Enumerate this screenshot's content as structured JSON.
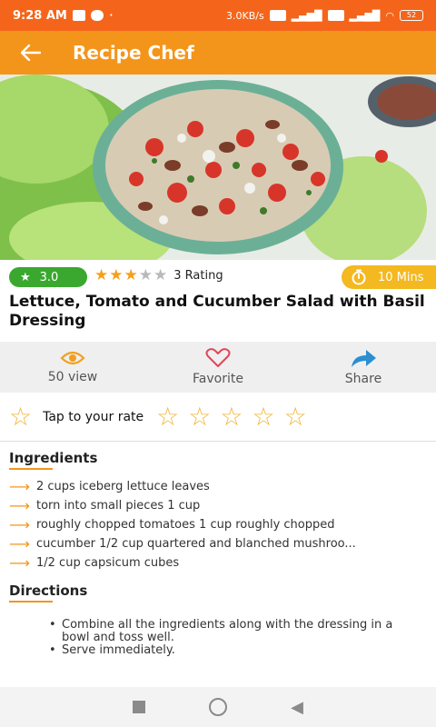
{
  "status_bar": {
    "time": "9:28 AM",
    "network": "3.0KB/s",
    "battery": "52"
  },
  "app_bar": {
    "title": "Recipe Chef",
    "back_icon": "back-arrow-icon"
  },
  "recipe": {
    "score": "3.0",
    "stars_filled": 3,
    "stars_total": 5,
    "rating_label": "3 Rating",
    "time": "10 Mins",
    "title": "Lettuce, Tomato and Cucumber Salad with Basil Dressing"
  },
  "actions": [
    {
      "label": "50 view",
      "icon": "eye-icon"
    },
    {
      "label": "Favorite",
      "icon": "heart-icon"
    },
    {
      "label": "Share",
      "icon": "share-icon"
    }
  ],
  "rate": {
    "label": "Tap to your rate"
  },
  "ingredients": {
    "title": "Ingredients",
    "items": [
      "2 cups iceberg lettuce leaves",
      "torn into small pieces 1 cup",
      "roughly chopped tomatoes 1 cup roughly chopped",
      "cucumber 1/2 cup quartered and blanched mushroo...",
      "1/2 cup capsicum cubes"
    ]
  },
  "directions": {
    "title": "Directions",
    "items": [
      "Combine all the ingredients along with the dressing in a bowl and toss well.",
      "Serve immediately."
    ]
  },
  "colors": {
    "status_bar": "#f4651b",
    "app_bar": "#f4951b",
    "score_pill": "#3aa82f",
    "time_pill": "#f4b820",
    "star": "#f5a01a",
    "view_icon": "#f0a020",
    "heart_icon": "#e0455a",
    "share_icon": "#2b8fd1"
  }
}
